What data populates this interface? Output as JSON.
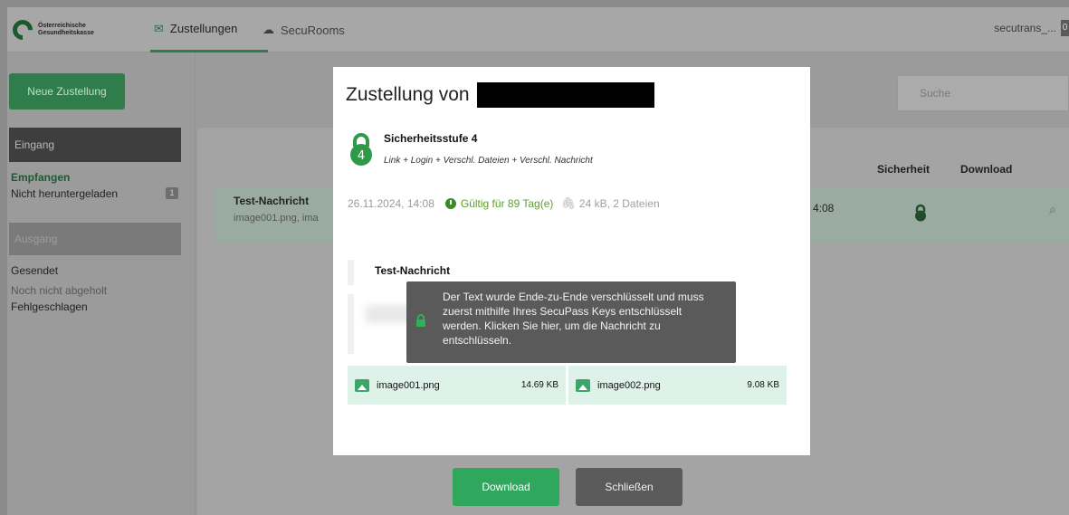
{
  "brand": {
    "line1": "Österreichische",
    "line2": "Gesundheitskasse",
    "accent": "#2e7d4a"
  },
  "nav": {
    "tabs": [
      {
        "label": "Zustellungen",
        "icon": "envelope-icon",
        "active": true
      },
      {
        "label": "SecuRooms",
        "icon": "cloud-icon",
        "active": false
      }
    ],
    "user": "secutrans_...",
    "user_badge": "0"
  },
  "sidebar": {
    "new_button": "Neue Zustellung",
    "inbox_header": "Eingang",
    "inbox_items": [
      {
        "label": "Empfangen",
        "active": true
      },
      {
        "label": "Nicht heruntergeladen",
        "count": "1"
      }
    ],
    "outbox_header": "Ausgang",
    "outbox_items": [
      {
        "label": "Gesendet"
      },
      {
        "label": "Noch nicht abgeholt"
      },
      {
        "label": "Fehlgeschlagen"
      }
    ]
  },
  "list": {
    "search_placeholder": "Suche",
    "columns": {
      "security": "Sicherheit",
      "download": "Download"
    },
    "rows": [
      {
        "title": "Test-Nachricht",
        "subtitle": "image001.png, ima",
        "time": "4:08"
      }
    ]
  },
  "modal": {
    "title": "Zustellung von",
    "security_level": "Sicherheitsstufe 4",
    "security_level_number": "4",
    "security_desc": "Link + Login + Verschl. Dateien + Verschl. Nachricht",
    "date": "26.11.2024, 14:08",
    "validity": "Gültig für 89 Tag(e)",
    "size": "24 kB, 2 Dateien",
    "message_subject": "Test-Nachricht",
    "tooltip": "Der Text wurde Ende-zu-Ende verschlüsselt und muss zuerst mithilfe Ihres SecuPass Keys entschlüsselt werden. Klicken Sie hier, um die Nachricht zu entschlüsseln.",
    "files": [
      {
        "name": "image001.png",
        "size": "14.69 KB"
      },
      {
        "name": "image002.png",
        "size": "9.08 KB"
      }
    ]
  },
  "footer": {
    "download_label": "Download",
    "close_label": "Schließen"
  }
}
